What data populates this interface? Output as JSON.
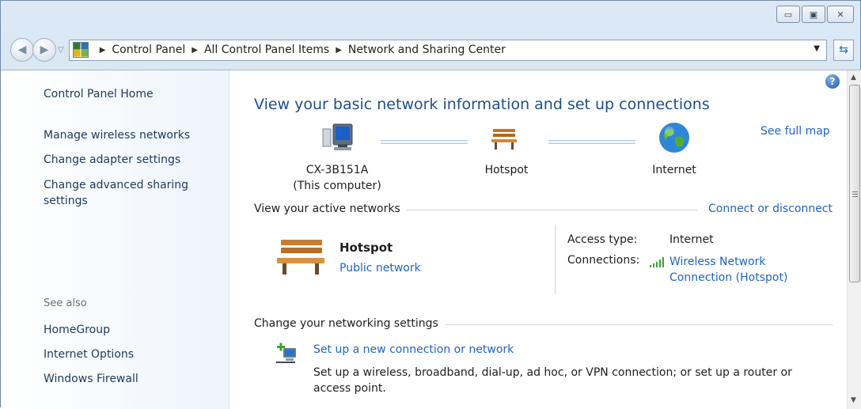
{
  "window": {
    "caption_buttons": {
      "minimize": "▭",
      "maximize": "▣",
      "close": "✕"
    }
  },
  "nav": {
    "breadcrumb": [
      "Control Panel",
      "All Control Panel Items",
      "Network and Sharing Center"
    ]
  },
  "sidebar": {
    "home": "Control Panel Home",
    "links": [
      "Manage wireless networks",
      "Change adapter settings",
      "Change advanced sharing settings"
    ],
    "see_also_label": "See also",
    "see_also": [
      "HomeGroup",
      "Internet Options",
      "Windows Firewall"
    ]
  },
  "main": {
    "heading": "View your basic network information and set up connections",
    "see_full_map": "See full map",
    "map": {
      "computer_name": "CX-3B151A",
      "computer_sub": "(This computer)",
      "network_name": "Hotspot",
      "internet_label": "Internet"
    },
    "active_networks": {
      "title": "View your active networks",
      "connect_link": "Connect or disconnect",
      "network_name": "Hotspot",
      "network_type": "Public network",
      "access_type_label": "Access type:",
      "access_type_value": "Internet",
      "connections_label": "Connections:",
      "connection_link_line1": "Wireless Network",
      "connection_link_line2": "Connection (Hotspot)"
    },
    "change_settings": {
      "title": "Change your networking settings",
      "task1_link": "Set up a new connection or network",
      "task1_desc_line1": "Set up a wireless, broadband, dial-up, ad hoc, or VPN connection; or set up a router or",
      "task1_desc_line2": "access point."
    }
  },
  "icons": {
    "computer": "computer-icon",
    "bench": "bench-icon",
    "globe": "globe-icon",
    "help": "help-icon",
    "signal": "wifi-signal-icon",
    "new_connection": "new-connection-icon"
  }
}
